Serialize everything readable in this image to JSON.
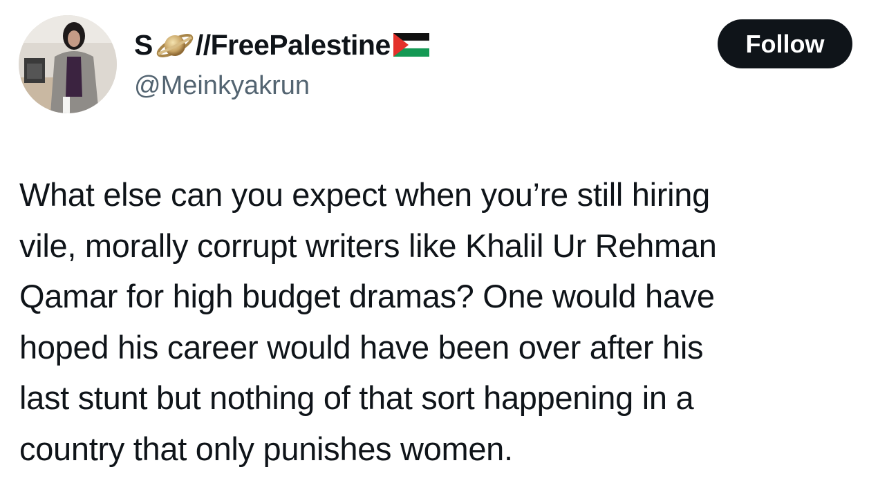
{
  "author": {
    "name_prefix": "S",
    "name_suffix": "//FreePalestine",
    "planet_emoji": "ringed-planet-icon",
    "flag_emoji": "palestine-flag-icon",
    "handle": "@Meinkyakrun"
  },
  "actions": {
    "follow_label": "Follow"
  },
  "tweet": {
    "text": "What else can you expect when you’re still hiring\nvile, morally corrupt writers like Khalil Ur Rehman\nQamar for high budget dramas? One would have\nhoped his career would have been over after his\nlast stunt but nothing of that sort happening in a\ncountry that only punishes women."
  },
  "colors": {
    "text": "#0f1419",
    "secondary": "#536471",
    "button_bg": "#0f1419",
    "button_text": "#ffffff",
    "background": "#ffffff"
  }
}
